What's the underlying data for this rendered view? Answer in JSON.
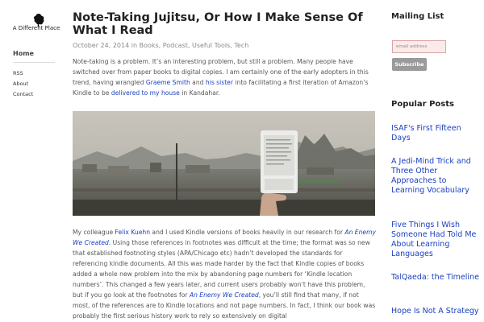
{
  "site": {
    "name": "A Different Place",
    "nav": {
      "home": "Home",
      "rss": "RSS",
      "about": "About",
      "contact": "Contact"
    }
  },
  "post": {
    "title": "Note-Taking Jujitsu, Or How I Make Sense Of What I Read",
    "date": "October 24, 2014",
    "meta_in": " in ",
    "categories": [
      "Books",
      "Podcast",
      "Useful Tools",
      "Tech"
    ],
    "p1": {
      "t1": "Note-taking is a problem. It’s an interesting problem, but still a problem. Many people have switched over from paper books to digital copies. I am certainly one of the early adopters in this trend, having wrangled ",
      "l1": "Graeme Smith",
      "t2": " and ",
      "l2": "his sister",
      "t3": " into facilitating a first iteration of Amazon’s Kindle to be ",
      "l3": "delivered to my house",
      "t4": " in Kandahar."
    },
    "p2": {
      "t1": "My colleague ",
      "l1": "Felix Kuehn",
      "t2": " and I used Kindle versions of books heavily in our research for ",
      "l2": "An Enemy We Created",
      "t3": ". Using those references in footnotes was difficult at the time; the format was so new that established footnoting styles (APA/Chicago etc) hadn’t developed the standards for referencing kindle documents. All this was made harder by the fact that Kindle copies of books added a whole new problem into the mix by abandoning page numbers for ‘Kindle location numbers’. This changed a few years later, and current users probably won’t have this problem, but if you go look at the footnotes for ",
      "l3": "An Enemy We Created",
      "t4": ", you’ll still find that many, if not most, of the references are to Kindle locations and not page numbers. In fact, I think our book was probably the first serious history work to rely so extensively on digital"
    }
  },
  "mailing": {
    "title": "Mailing List",
    "placeholder": "email address",
    "button": "Subscribe"
  },
  "popular": {
    "title": "Popular Posts",
    "items": [
      "ISAF's First Fifteen Days",
      "A Jedi-Mind Trick and Three Other Approaches to Learning Vocabulary",
      "Five Things I Wish Someone Had Told Me About Learning Languages",
      "TalQaeda: the Timeline",
      "Hope Is Not A Strategy"
    ]
  },
  "colors": {
    "link": "#1a3fbf",
    "meta": "#8a8a8a",
    "button": "#9a9a9a",
    "input_bg": "#fbeaea"
  },
  "icons": {
    "logo": "ink-blot-logo-icon"
  }
}
